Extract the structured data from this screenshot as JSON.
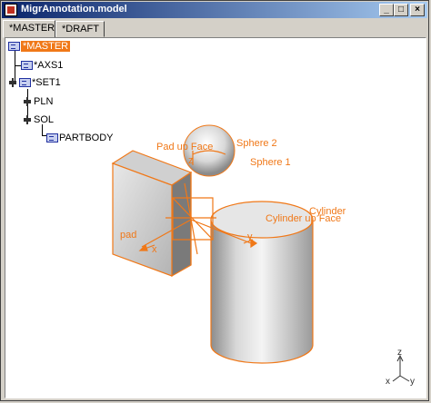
{
  "window": {
    "title": "MigrAnnotation.model",
    "buttons": {
      "minimize": "_",
      "maximize": "□",
      "close": "×"
    }
  },
  "tabs": [
    {
      "label": "*MASTER",
      "active": true
    },
    {
      "label": "*DRAFT",
      "active": false
    }
  ],
  "tree": {
    "master": "*MASTER",
    "axs": "*AXS1",
    "set": "*SET1",
    "pln": "PLN",
    "sol": "SOL",
    "partbody": "PARTBODY"
  },
  "scene": {
    "labels": {
      "pad_up_face": "Pad up Face",
      "sphere2": "Sphere 2",
      "sphere1": "Sphere 1",
      "cylinder": "Cylinder",
      "cylinder_up_face": "Cylinder up Face",
      "pad": "pad",
      "axis_x": "x",
      "axis_y": "y",
      "axis_z": "z"
    },
    "triad": {
      "x": "x",
      "y": "y",
      "z": "z"
    },
    "colors": {
      "annotation": "#f07818",
      "highlight": "#f07818"
    }
  }
}
